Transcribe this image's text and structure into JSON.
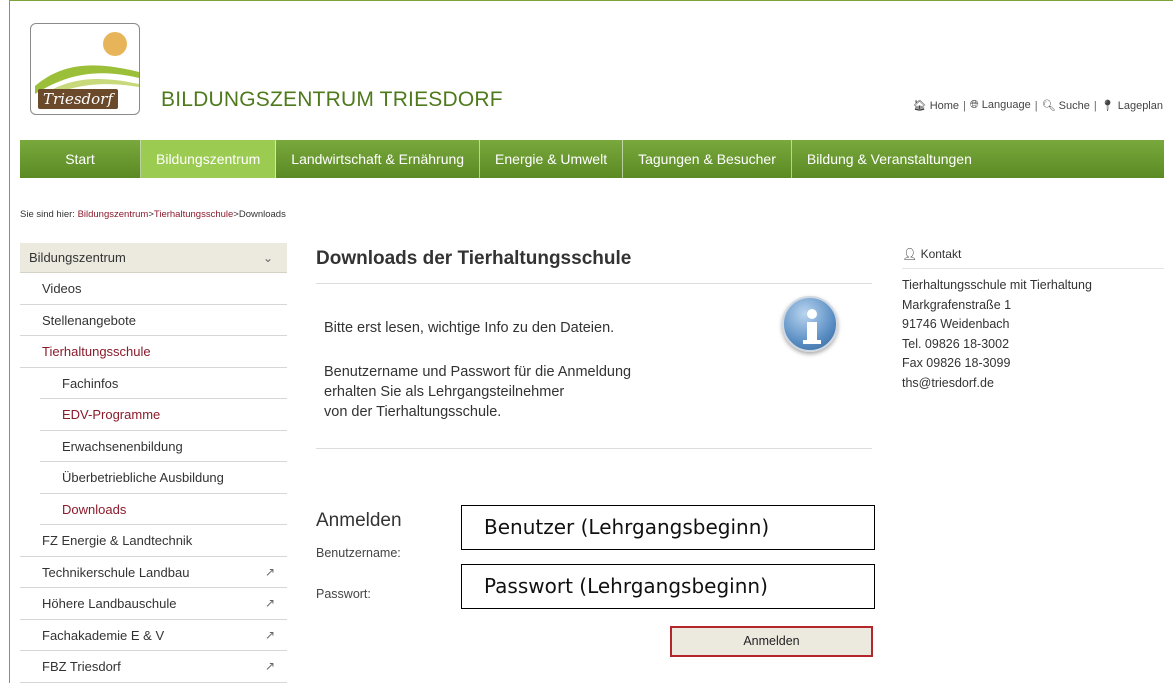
{
  "header": {
    "logo_text": "Triesdorf",
    "site_title": "BILDUNGSZENTRUM TRIESDORF",
    "util_links": [
      {
        "icon": "home-icon",
        "label": "Home"
      },
      {
        "icon": "globe-icon",
        "label": "Language"
      },
      {
        "icon": "search-icon",
        "label": "Suche"
      },
      {
        "icon": "map-marker-icon",
        "label": "Lageplan"
      }
    ]
  },
  "nav": {
    "items": [
      "Start",
      "Bildungszentrum",
      "Landwirtschaft & Ernährung",
      "Energie & Umwelt",
      "Tagungen & Besucher",
      "Bildung & Veranstaltungen"
    ],
    "active_index": 1
  },
  "breadcrumb": {
    "prefix": "Sie sind hier:",
    "links": [
      "Bildungszentrum",
      "Tierhaltungsschule"
    ],
    "separator": ">",
    "current": "Downloads"
  },
  "sidebar": {
    "head": "Bildungszentrum",
    "items": [
      {
        "label": "Videos",
        "level": 1,
        "red": false,
        "external": false
      },
      {
        "label": "Stellenangebote",
        "level": 1,
        "red": false,
        "external": false
      },
      {
        "label": "Tierhaltungsschule",
        "level": 1,
        "red": true,
        "external": false
      },
      {
        "label": "Fachinfos",
        "level": 2,
        "red": false,
        "external": false
      },
      {
        "label": "EDV-Programme",
        "level": 2,
        "red": true,
        "external": false
      },
      {
        "label": "Erwachsenenbildung",
        "level": 2,
        "red": false,
        "external": false
      },
      {
        "label": "Überbetriebliche Ausbildung",
        "level": 2,
        "red": false,
        "external": false
      },
      {
        "label": "Downloads",
        "level": 2,
        "red": true,
        "external": false
      },
      {
        "label": "FZ Energie & Landtechnik",
        "level": 1,
        "red": false,
        "external": false
      },
      {
        "label": "Technikerschule Landbau",
        "level": 1,
        "red": false,
        "external": true
      },
      {
        "label": "Höhere Landbauschule",
        "level": 1,
        "red": false,
        "external": true
      },
      {
        "label": "Fachakademie E & V",
        "level": 1,
        "red": false,
        "external": true
      },
      {
        "label": "FBZ Triesdorf",
        "level": 1,
        "red": false,
        "external": true
      }
    ]
  },
  "main": {
    "title": "Downloads der Tierhaltungsschule",
    "info_line": "Bitte erst lesen, wichtige Info zu den Dateien.",
    "info_lines": [
      "Benutzername und Passwort für die Anmeldung",
      "erhalten Sie als Lehrgangsteilnehmer",
      "von der Tierhaltungsschule."
    ],
    "login": {
      "heading": "Anmelden",
      "username_label": "Benutzername:",
      "username_value": "Benutzer (Lehrgangsbeginn)",
      "password_label": "Passwort:",
      "password_value": "Passwort (Lehrgangsbeginn)",
      "button": "Anmelden"
    }
  },
  "contact": {
    "heading": "Kontakt",
    "lines": [
      "Tierhaltungsschule mit Tierhaltung",
      "Markgrafenstraße 1",
      "91746 Weidenbach",
      "Tel. 09826 18-3002",
      "Fax 09826 18-3099",
      "ths@triesdorf.de"
    ]
  },
  "colors": {
    "nav_green": "#6b9a2f",
    "nav_active": "#9ccb52",
    "link_red": "#8a1b2b",
    "title_green": "#4f7a1c"
  }
}
